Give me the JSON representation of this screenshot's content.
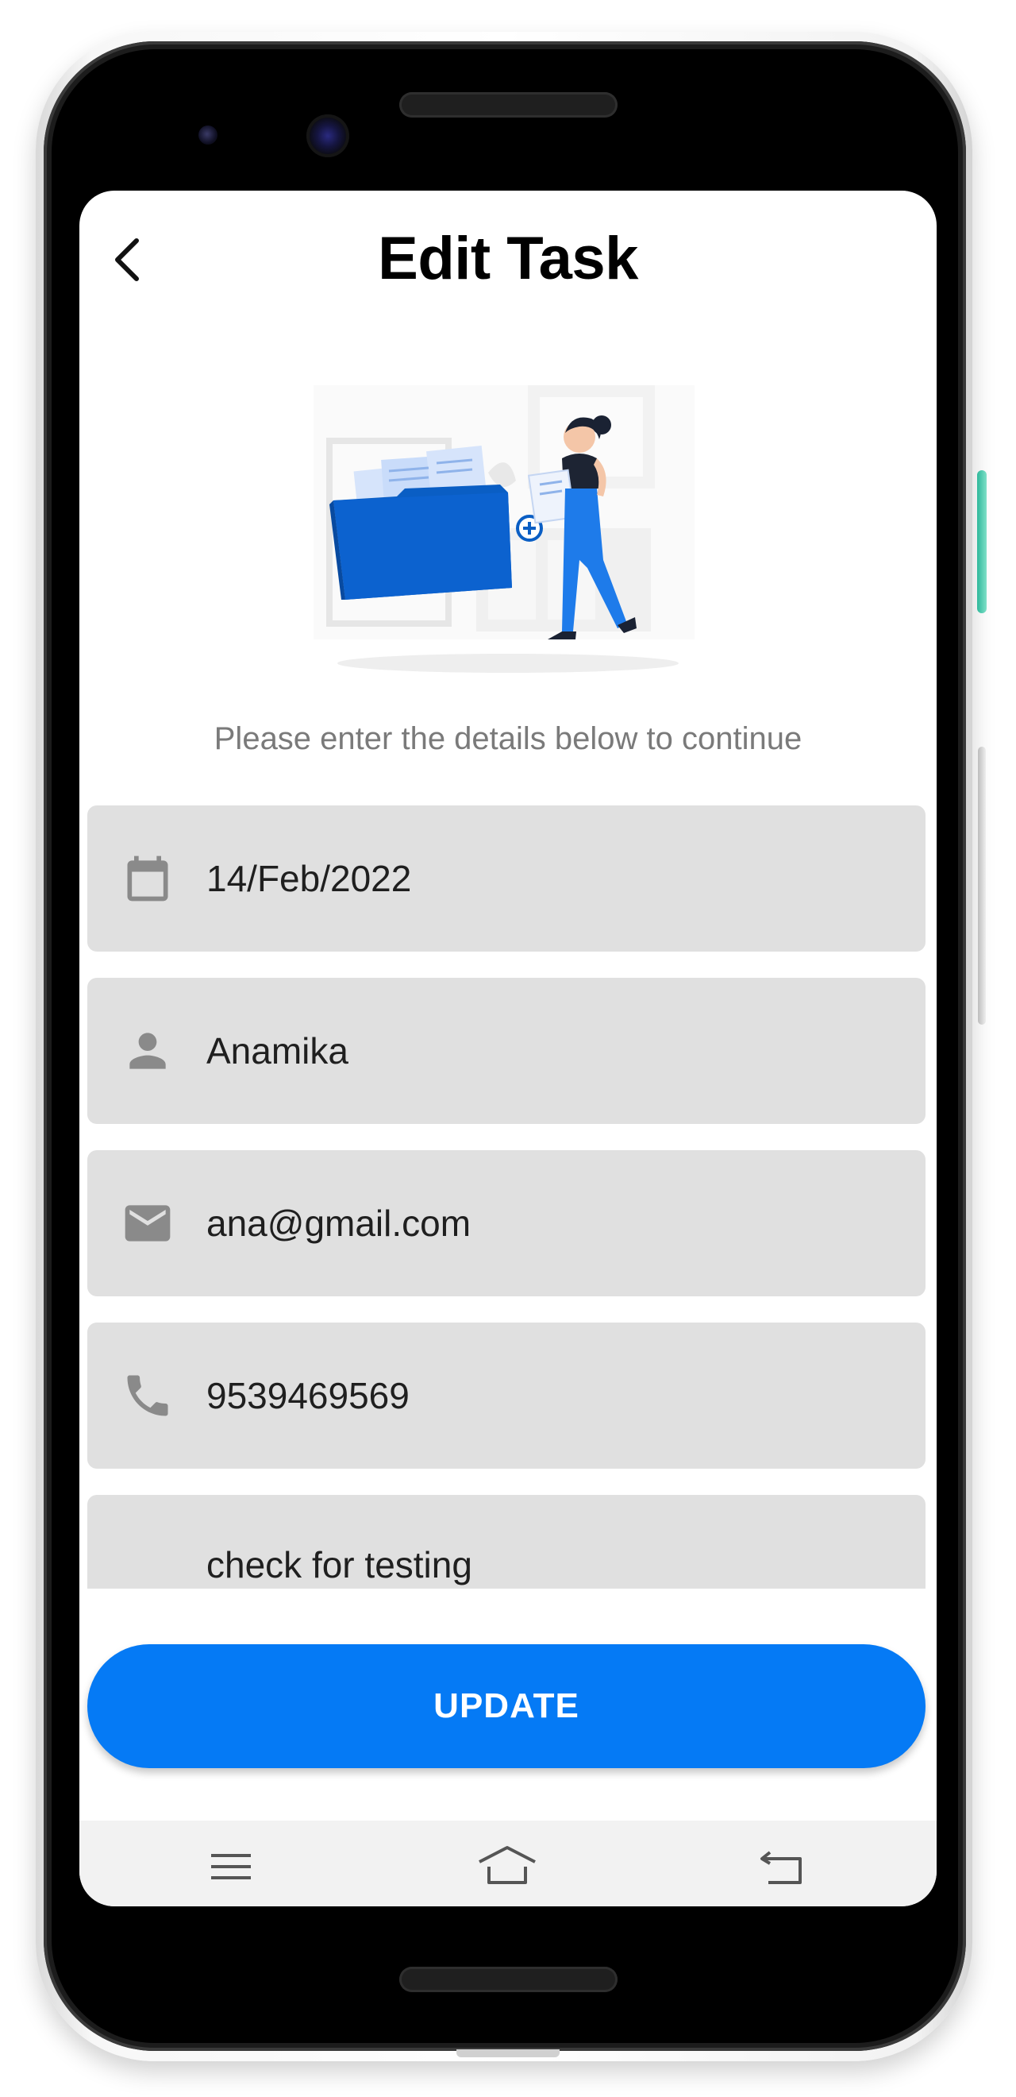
{
  "header": {
    "title": "Edit Task",
    "back_icon": "chevron-left-icon"
  },
  "subtitle": "Please enter the details below to continue",
  "form": {
    "fields": [
      {
        "icon": "calendar-icon",
        "value": "14/Feb/2022"
      },
      {
        "icon": "person-icon",
        "value": "Anamika"
      },
      {
        "icon": "mail-icon",
        "value": "ana@gmail.com"
      },
      {
        "icon": "phone-icon",
        "value": "9539469569"
      },
      {
        "icon": "",
        "value": "check for testing"
      }
    ]
  },
  "update_button": {
    "label": "UPDATE"
  },
  "nav_bar": {
    "items": [
      "menu-icon",
      "home-icon",
      "back-icon"
    ]
  },
  "colors": {
    "accent": "#057af5",
    "field_bg": "#e0e0e0",
    "icon_grey": "#8a8a8a",
    "illustration_blue": "#0a5ec4"
  }
}
